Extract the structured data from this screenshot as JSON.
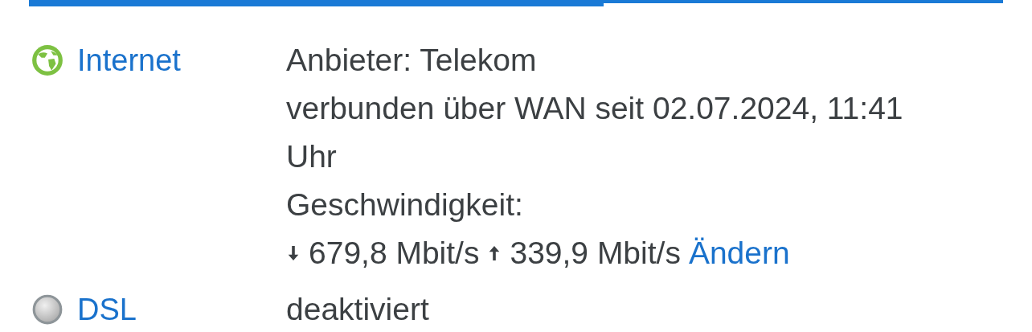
{
  "progress": {
    "level": 0.59
  },
  "connections": [
    {
      "name": "Internet",
      "kind": "online",
      "lines": [
        "Anbieter: Telekom",
        "verbunden über WAN seit 02.07.2024, 11:41 Uhr",
        "Geschwindigkeit:"
      ],
      "speed": {
        "downstream": "679,8 Mbit/s",
        "upstream": "339,9 Mbit/s",
        "link": "Ändern"
      }
    },
    {
      "name": "DSL",
      "kind": "inactive",
      "lines": [
        "deaktiviert"
      ]
    }
  ]
}
